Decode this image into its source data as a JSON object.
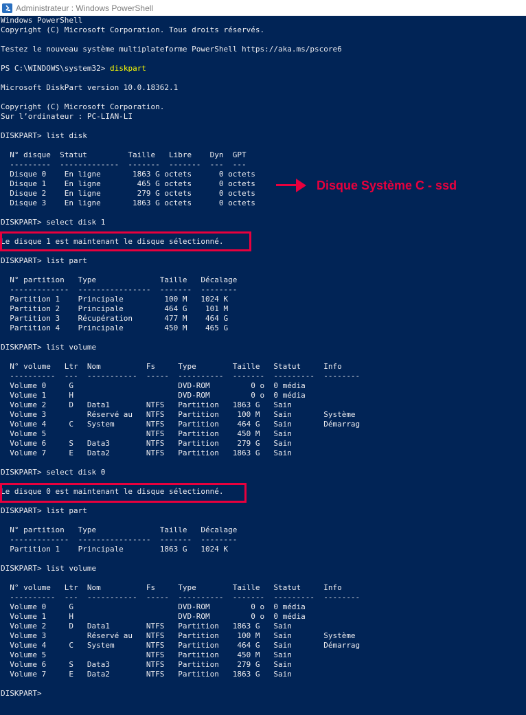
{
  "window": {
    "title": "Administrateur : Windows PowerShell",
    "icon": "powershell-icon",
    "background_color": "#012456",
    "text_color": "#eeedf0",
    "command_color": "#ffff00",
    "annotation_color": "#e8003d"
  },
  "console": {
    "lines": [
      {
        "text": "Windows PowerShell"
      },
      {
        "text": "Copyright (C) Microsoft Corporation. Tous droits réservés."
      },
      {
        "text": ""
      },
      {
        "text": "Testez le nouveau système multiplateforme PowerShell https://aka.ms/pscore6"
      },
      {
        "text": ""
      },
      {
        "text": "PS C:\\WINDOWS\\system32> ",
        "cmd": "diskpart"
      },
      {
        "text": ""
      },
      {
        "text": "Microsoft DiskPart version 10.0.18362.1"
      },
      {
        "text": ""
      },
      {
        "text": "Copyright (C) Microsoft Corporation."
      },
      {
        "text": "Sur l’ordinateur : PC-LIAN-LI"
      },
      {
        "text": ""
      },
      {
        "text": "DISKPART> list disk"
      },
      {
        "text": ""
      },
      {
        "text": "  N° disque  Statut         Taille   Libre    Dyn  GPT"
      },
      {
        "text": "  ---------  -------------  -------  -------  ---  ---"
      },
      {
        "text": "  Disque 0    En ligne       1863 G octets      0 octets"
      },
      {
        "text": "  Disque 1    En ligne        465 G octets      0 octets"
      },
      {
        "text": "  Disque 2    En ligne        279 G octets      0 octets"
      },
      {
        "text": "  Disque 3    En ligne       1863 G octets      0 octets"
      },
      {
        "text": ""
      },
      {
        "text": "DISKPART> select disk 1"
      },
      {
        "text": ""
      },
      {
        "text": "Le disque 1 est maintenant le disque sélectionné."
      },
      {
        "text": ""
      },
      {
        "text": "DISKPART> list part"
      },
      {
        "text": ""
      },
      {
        "text": "  N° partition   Type              Taille   Décalage"
      },
      {
        "text": "  -------------  ----------------  -------  --------"
      },
      {
        "text": "  Partition 1    Principale         100 M   1024 K"
      },
      {
        "text": "  Partition 2    Principale         464 G    101 M"
      },
      {
        "text": "  Partition 3    Récupération       477 M    464 G"
      },
      {
        "text": "  Partition 4    Principale         450 M    465 G"
      },
      {
        "text": ""
      },
      {
        "text": "DISKPART> list volume"
      },
      {
        "text": ""
      },
      {
        "text": "  N° volume   Ltr  Nom          Fs     Type        Taille   Statut     Info"
      },
      {
        "text": "  ----------  ---  -----------  -----  ----------  -------  ---------  --------"
      },
      {
        "text": "  Volume 0     G                       DVD-ROM         0 o  0 média"
      },
      {
        "text": "  Volume 1     H                       DVD-ROM         0 o  0 média"
      },
      {
        "text": "  Volume 2     D   Data1        NTFS   Partition   1863 G   Sain"
      },
      {
        "text": "  Volume 3         Réservé au   NTFS   Partition    100 M   Sain       Système"
      },
      {
        "text": "  Volume 4     C   System       NTFS   Partition    464 G   Sain       Démarrag"
      },
      {
        "text": "  Volume 5                      NTFS   Partition    450 M   Sain"
      },
      {
        "text": "  Volume 6     S   Data3        NTFS   Partition    279 G   Sain"
      },
      {
        "text": "  Volume 7     E   Data2        NTFS   Partition   1863 G   Sain"
      },
      {
        "text": ""
      },
      {
        "text": "DISKPART> select disk 0"
      },
      {
        "text": ""
      },
      {
        "text": "Le disque 0 est maintenant le disque sélectionné."
      },
      {
        "text": ""
      },
      {
        "text": "DISKPART> list part"
      },
      {
        "text": ""
      },
      {
        "text": "  N° partition   Type              Taille   Décalage"
      },
      {
        "text": "  -------------  ----------------  -------  --------"
      },
      {
        "text": "  Partition 1    Principale        1863 G   1024 K"
      },
      {
        "text": ""
      },
      {
        "text": "DISKPART> list volume"
      },
      {
        "text": ""
      },
      {
        "text": "  N° volume   Ltr  Nom          Fs     Type        Taille   Statut     Info"
      },
      {
        "text": "  ----------  ---  -----------  -----  ----------  -------  ---------  --------"
      },
      {
        "text": "  Volume 0     G                       DVD-ROM         0 o  0 média"
      },
      {
        "text": "  Volume 1     H                       DVD-ROM         0 o  0 média"
      },
      {
        "text": "  Volume 2     D   Data1        NTFS   Partition   1863 G   Sain"
      },
      {
        "text": "  Volume 3         Réservé au   NTFS   Partition    100 M   Sain       Système"
      },
      {
        "text": "  Volume 4     C   System       NTFS   Partition    464 G   Sain       Démarrag"
      },
      {
        "text": "  Volume 5                      NTFS   Partition    450 M   Sain"
      },
      {
        "text": "  Volume 6     S   Data3        NTFS   Partition    279 G   Sain"
      },
      {
        "text": "  Volume 7     E   Data2        NTFS   Partition   1863 G   Sain"
      },
      {
        "text": ""
      },
      {
        "text": "DISKPART> "
      }
    ]
  },
  "annotation": {
    "label": "Disque Système C - ssd",
    "icon": "arrow-right-icon"
  }
}
